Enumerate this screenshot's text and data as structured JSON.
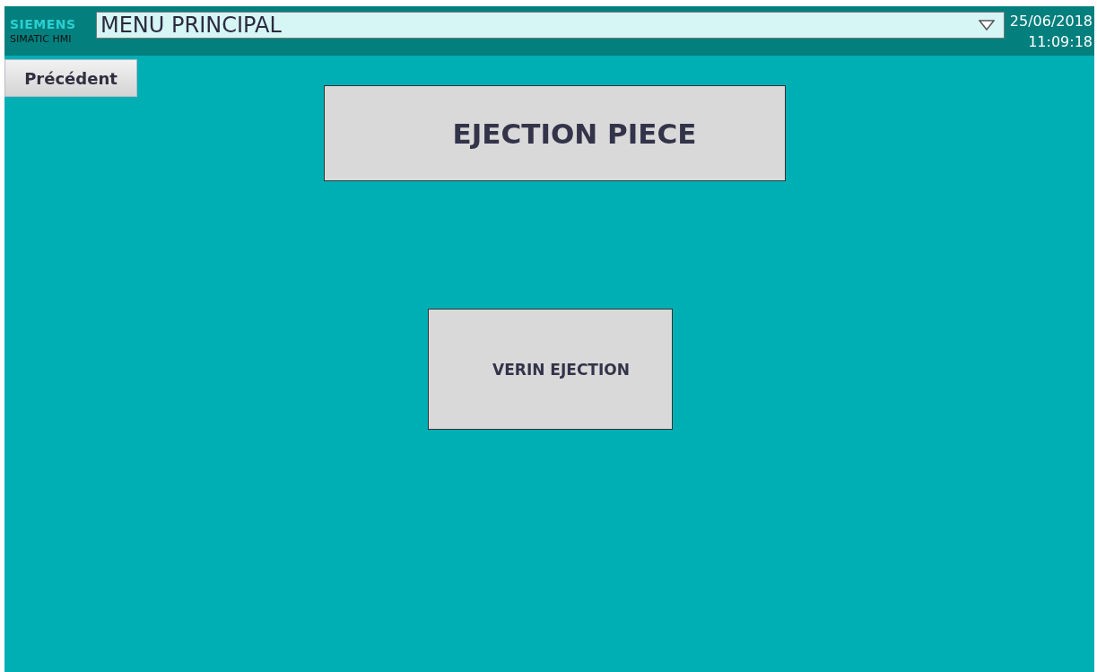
{
  "header": {
    "brand": "SIEMENS",
    "product": "SIMATIC HMI",
    "screen_selector": {
      "value": "MENU PRINCIPAL"
    },
    "date": "25/06/2018",
    "time": "11:09:18"
  },
  "back_button": {
    "label": "Précédent"
  },
  "title": "EJECTION PIECE",
  "buttons": [
    {
      "label": "VERIN EJECTION"
    }
  ]
}
